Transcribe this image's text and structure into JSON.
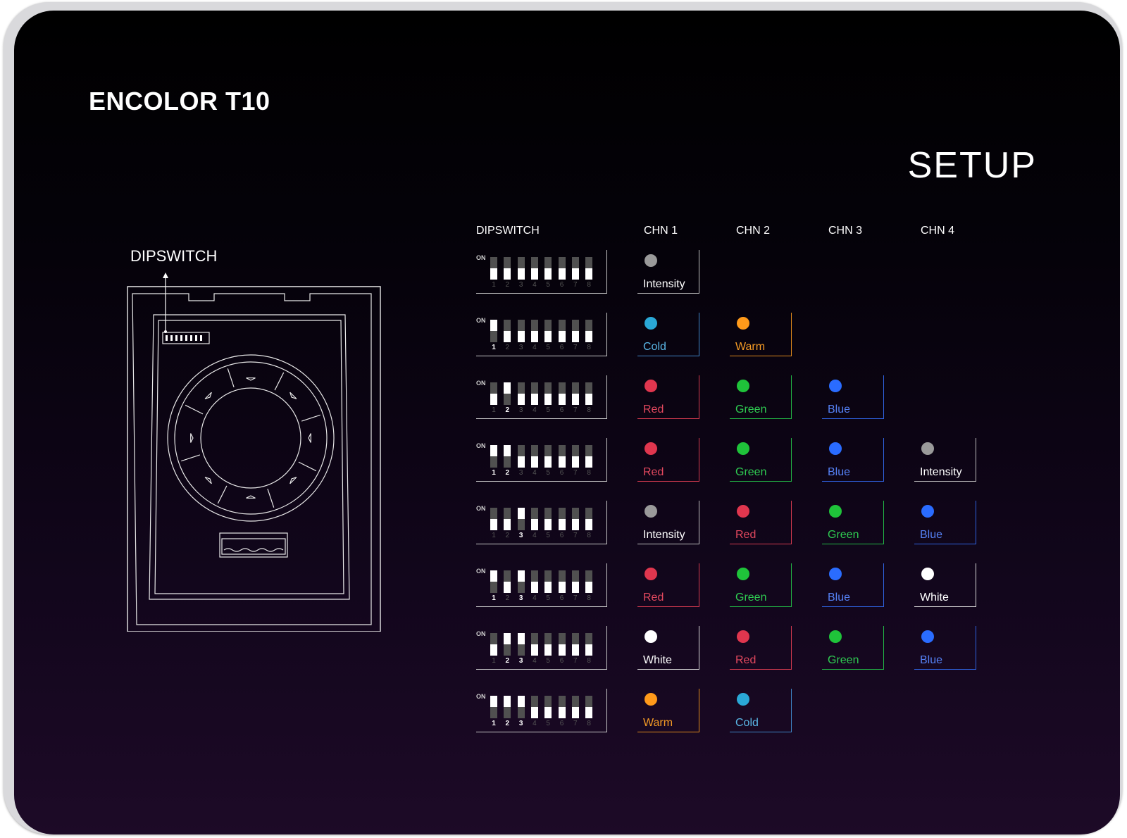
{
  "header": {
    "device_title": "ENCOLOR T10",
    "setup_title": "SETUP"
  },
  "device": {
    "label": "DIPSWITCH"
  },
  "table": {
    "headers": [
      "DIPSWITCH",
      "CHN 1",
      "CHN 2",
      "CHN 3",
      "CHN 4"
    ],
    "dip_on_label": "ON",
    "switch_numbers": [
      "1",
      "2",
      "3",
      "4",
      "5",
      "6",
      "7",
      "8"
    ],
    "rows": [
      {
        "on_switches": [],
        "channels": [
          {
            "label": "Intensity",
            "color": "#9a9a9a",
            "text_color": "#ffffff",
            "border_color": "#bdbdbd"
          }
        ]
      },
      {
        "on_switches": [
          1
        ],
        "channels": [
          {
            "label": "Cold",
            "color": "#2aa8d6",
            "text_color": "#5ab7e6",
            "border_color": "#3f86c8"
          },
          {
            "label": "Warm",
            "color": "#ff9a1a",
            "text_color": "#f59b25",
            "border_color": "#e08a1c"
          }
        ]
      },
      {
        "on_switches": [
          2
        ],
        "channels": [
          {
            "label": "Red",
            "color": "#e0364e",
            "text_color": "#e2485e",
            "border_color": "#d43a4f"
          },
          {
            "label": "Green",
            "color": "#1fc33a",
            "text_color": "#2fcc52",
            "border_color": "#22b545"
          },
          {
            "label": "Blue",
            "color": "#2a6cff",
            "text_color": "#5581f5",
            "border_color": "#2f62e0"
          }
        ]
      },
      {
        "on_switches": [
          1,
          2
        ],
        "channels": [
          {
            "label": "Red",
            "color": "#e0364e",
            "text_color": "#e2485e",
            "border_color": "#d43a4f"
          },
          {
            "label": "Green",
            "color": "#1fc33a",
            "text_color": "#2fcc52",
            "border_color": "#22b545"
          },
          {
            "label": "Blue",
            "color": "#2a6cff",
            "text_color": "#5581f5",
            "border_color": "#2f62e0"
          },
          {
            "label": "Intensity",
            "color": "#9a9a9a",
            "text_color": "#ffffff",
            "border_color": "#bdbdbd"
          }
        ]
      },
      {
        "on_switches": [
          3
        ],
        "channels": [
          {
            "label": "Intensity",
            "color": "#9a9a9a",
            "text_color": "#ffffff",
            "border_color": "#bdbdbd"
          },
          {
            "label": "Red",
            "color": "#e0364e",
            "text_color": "#e2485e",
            "border_color": "#d43a4f"
          },
          {
            "label": "Green",
            "color": "#1fc33a",
            "text_color": "#2fcc52",
            "border_color": "#22b545"
          },
          {
            "label": "Blue",
            "color": "#2a6cff",
            "text_color": "#5581f5",
            "border_color": "#2f62e0"
          }
        ]
      },
      {
        "on_switches": [
          1,
          3
        ],
        "channels": [
          {
            "label": "Red",
            "color": "#e0364e",
            "text_color": "#e2485e",
            "border_color": "#d43a4f"
          },
          {
            "label": "Green",
            "color": "#1fc33a",
            "text_color": "#2fcc52",
            "border_color": "#22b545"
          },
          {
            "label": "Blue",
            "color": "#2a6cff",
            "text_color": "#5581f5",
            "border_color": "#2f62e0"
          },
          {
            "label": "White",
            "color": "#ffffff",
            "text_color": "#ffffff",
            "border_color": "#d8d8d8"
          }
        ]
      },
      {
        "on_switches": [
          2,
          3
        ],
        "channels": [
          {
            "label": "White",
            "color": "#ffffff",
            "text_color": "#ffffff",
            "border_color": "#d8d8d8"
          },
          {
            "label": "Red",
            "color": "#e0364e",
            "text_color": "#e2485e",
            "border_color": "#d43a4f"
          },
          {
            "label": "Green",
            "color": "#1fc33a",
            "text_color": "#2fcc52",
            "border_color": "#22b545"
          },
          {
            "label": "Blue",
            "color": "#2a6cff",
            "text_color": "#5581f5",
            "border_color": "#2f62e0"
          }
        ]
      },
      {
        "on_switches": [
          1,
          2,
          3
        ],
        "channels": [
          {
            "label": "Warm",
            "color": "#ff9a1a",
            "text_color": "#f59b25",
            "border_color": "#e08a1c"
          },
          {
            "label": "Cold",
            "color": "#2aa8d6",
            "text_color": "#5ab7e6",
            "border_color": "#3f86c8"
          }
        ]
      }
    ]
  }
}
